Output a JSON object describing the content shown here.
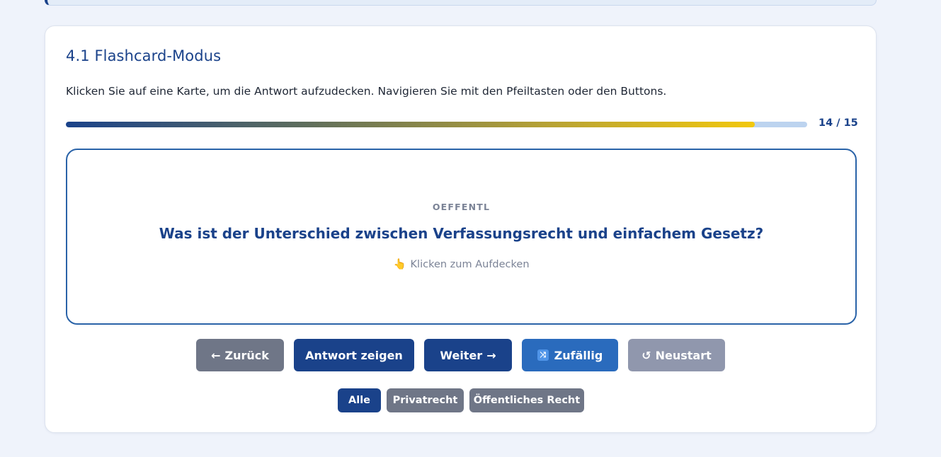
{
  "section": {
    "title": "4.1 Flashcard-Modus",
    "instructions": "Klicken Sie auf eine Karte, um die Antwort aufzudecken. Navigieren Sie mit den Pfeiltasten oder den Buttons."
  },
  "progress": {
    "current": 14,
    "total": 15,
    "label": "14 / 15",
    "fraction": 0.929
  },
  "card": {
    "category": "OEFFENTL",
    "question": "Was ist der Unterschied zwischen Verfassungsrecht und einfachem Gesetz?",
    "hint_icon": "pointing-hand-icon",
    "hint_emoji": "👆",
    "hint": "Klicken zum Aufdecken"
  },
  "buttons": {
    "back": {
      "icon": "←",
      "label": "Zurück"
    },
    "show_answer": {
      "label": "Antwort zeigen"
    },
    "next": {
      "label": "Weiter",
      "icon": "→"
    },
    "random": {
      "icon": "🔀",
      "label": "Zufällig"
    },
    "restart": {
      "icon": "↺",
      "label": "Neustart"
    }
  },
  "filters": [
    {
      "label": "Alle",
      "active": true
    },
    {
      "label": "Privatrecht",
      "active": false
    },
    {
      "label": "Öffentliches Recht",
      "active": false
    }
  ],
  "colors": {
    "primary": "#1a428a",
    "secondary_button": "#6f7687",
    "random_button": "#2a6bbd",
    "restart_button": "#9097ad",
    "progress_end": "#f2c80d",
    "progress_track": "#bcd3ef",
    "page_background": "#eff3fb"
  }
}
